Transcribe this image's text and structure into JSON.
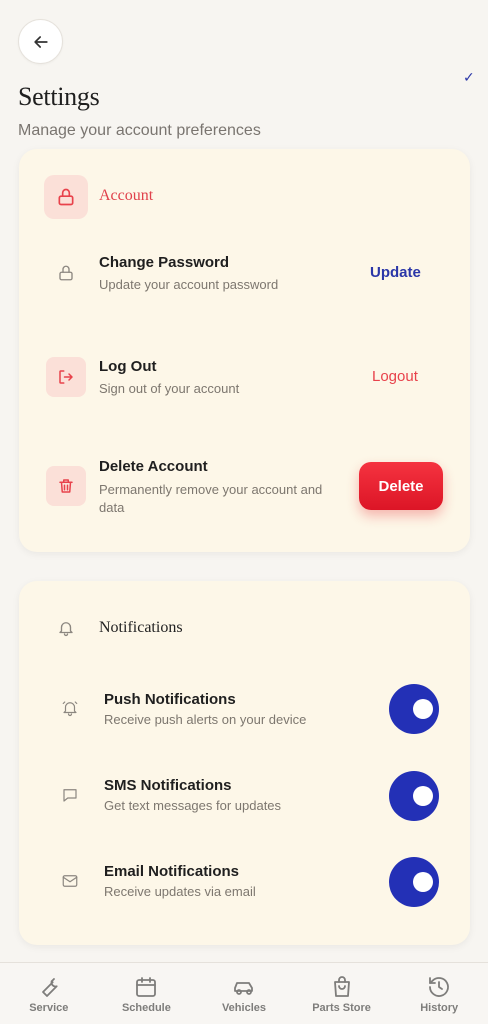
{
  "header": {
    "title": "Settings",
    "subtitle": "Manage your account preferences",
    "check_glyph": "✓"
  },
  "account": {
    "section_title": "Account",
    "rows": [
      {
        "title": "Change Password",
        "desc": "Update your account password",
        "action": "Update"
      },
      {
        "title": "Log Out",
        "desc": "Sign out of your account",
        "action": "Logout"
      },
      {
        "title": "Delete Account",
        "desc": "Permanently remove your account and data",
        "action": "Delete"
      }
    ]
  },
  "notifications": {
    "section_title": "Notifications",
    "rows": [
      {
        "title": "Push Notifications",
        "desc": "Receive push alerts on your device",
        "enabled": true
      },
      {
        "title": "SMS Notifications",
        "desc": "Get text messages for updates",
        "enabled": true
      },
      {
        "title": "Email Notifications",
        "desc": "Receive updates via email",
        "enabled": true
      }
    ]
  },
  "bottom_nav": [
    {
      "label": "Service",
      "icon": "wrench-icon"
    },
    {
      "label": "Schedule",
      "icon": "calendar-icon"
    },
    {
      "label": "Vehicles",
      "icon": "car-icon"
    },
    {
      "label": "Parts Store",
      "icon": "shopping-bag-icon"
    },
    {
      "label": "History",
      "icon": "history-icon"
    }
  ],
  "colors": {
    "accent_blue": "#2330b6",
    "danger_red": "#e8323f",
    "card_bg": "#fdf7e8",
    "icon_tint": "#fbe0d8"
  }
}
